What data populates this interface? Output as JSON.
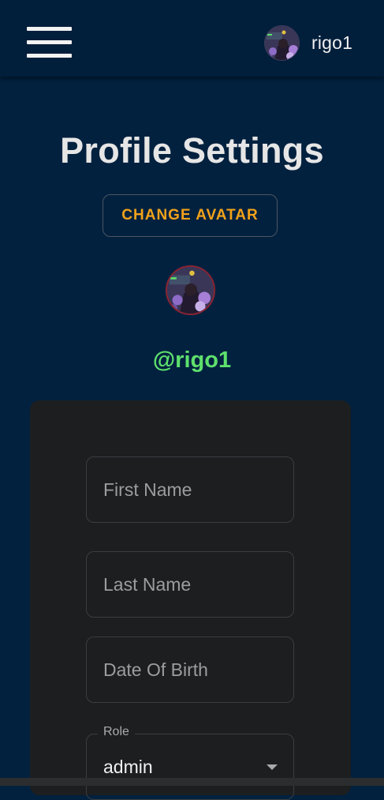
{
  "header": {
    "menu_icon": "hamburger-menu-icon",
    "username": "rigo1"
  },
  "page": {
    "title": "Profile Settings",
    "change_avatar_label": "CHANGE AVATAR",
    "handle": "@rigo1"
  },
  "form": {
    "first_name_placeholder": "First Name",
    "last_name_placeholder": "Last Name",
    "dob_placeholder": "Date Of Birth",
    "role_label": "Role",
    "role_value": "admin"
  },
  "colors": {
    "background": "#02213f",
    "appbar": "#011e3b",
    "accent_orange": "#f2a21a",
    "handle_green": "#5ee06c",
    "card": "#1c1e20"
  }
}
